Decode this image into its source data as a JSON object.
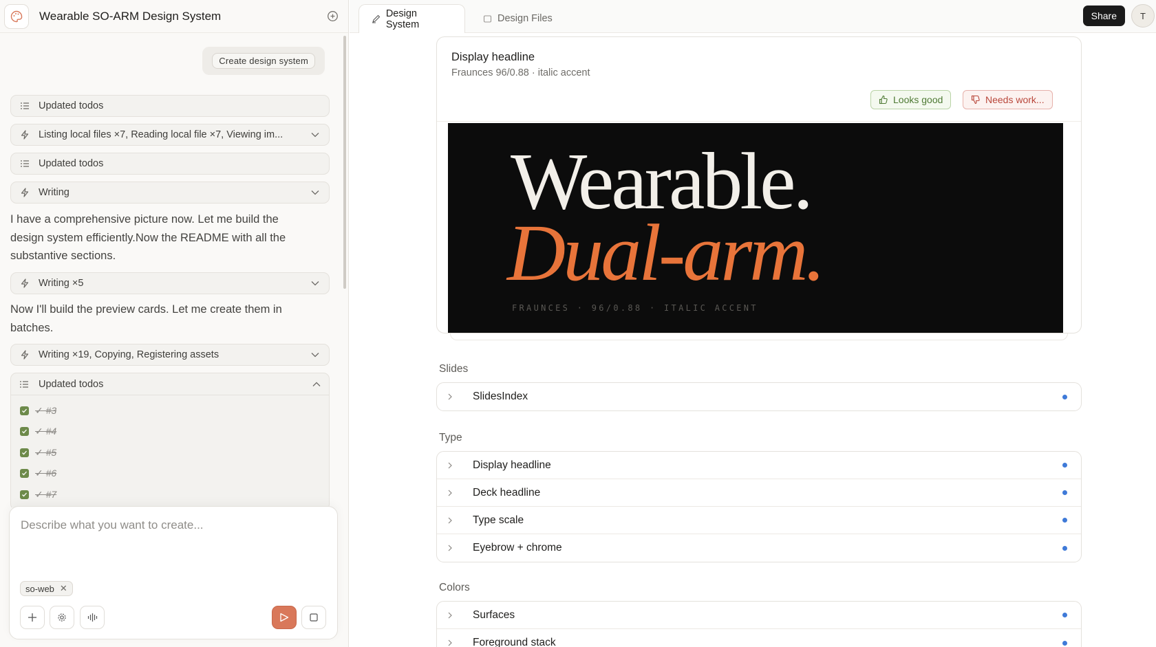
{
  "app": {
    "title": "Wearable SO-ARM Design System"
  },
  "chat": {
    "user_message": "Create design system",
    "rows": [
      {
        "icon": "list-icon",
        "label": "Updated todos",
        "chevron": false
      },
      {
        "icon": "bolt-icon",
        "label": "Listing local files ×7, Reading local file ×7, Viewing im...",
        "chevron": true
      },
      {
        "icon": "list-icon",
        "label": "Updated todos",
        "chevron": false
      },
      {
        "icon": "bolt-icon",
        "label": "Writing",
        "chevron": true
      }
    ],
    "paragraph_1": "I have a comprehensive picture now. Let me build the design system efficiently.Now the README with all the substantive sections.",
    "row_writing5": "Writing ×5",
    "paragraph_2": "Now I'll build the preview cards. Let me create them in batches.",
    "row_writing19": "Writing ×19, Copying, Registering assets",
    "todos": {
      "label": "Updated todos",
      "items": [
        "✓ #3",
        "✓ #4",
        "✓ #5",
        "✓ #6",
        "✓ #7"
      ]
    }
  },
  "composer": {
    "placeholder": "Describe what you want to create...",
    "tag": "so-web"
  },
  "tabs": {
    "active": "Design System",
    "inactive": "Design Files"
  },
  "header": {
    "share": "Share",
    "avatar": "T"
  },
  "card": {
    "title": "Display headline",
    "subtitle": "Fraunces 96/0.88 · italic accent",
    "looks_good": "Looks good",
    "needs_work": "Needs work...",
    "preview_line1": "Wearable.",
    "preview_line2": "Dual-arm.",
    "preview_eyebrow": "FRAUNCES · 96/0.88 · ITALIC ACCENT"
  },
  "sections": {
    "slides": {
      "title": "Slides",
      "items": [
        "SlidesIndex"
      ]
    },
    "type": {
      "title": "Type",
      "items": [
        "Display headline",
        "Deck headline",
        "Type scale",
        "Eyebrow + chrome"
      ]
    },
    "colors": {
      "title": "Colors",
      "items": [
        "Surfaces",
        "Foreground stack"
      ]
    }
  },
  "colors": {
    "accent": "#e8743a",
    "send": "#d9785a",
    "status_dot": "#3f7ad8",
    "check": "#6d8a4a"
  }
}
